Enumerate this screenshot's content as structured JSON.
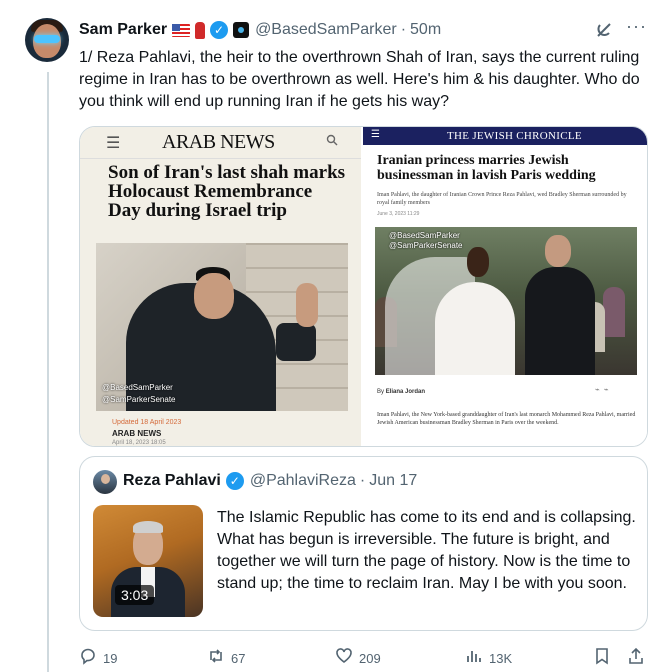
{
  "tweet": {
    "author_name": "Sam Parker",
    "author_handle": "@BasedSamParker",
    "time": "50m",
    "text": "1/ Reza Pahlavi, the heir to the overthrown Shah of Iran, says the current ruling regime in Iran has to be overthrown as well. Here's him & his daughter. Who do you think will end up running Iran if he gets his way?",
    "icons": {
      "grok": "grok-icon",
      "more": "more-icon",
      "verified": "verified-badge-icon",
      "flag": "us-flag-icon",
      "extinguisher": "fire-extinguisher-icon"
    }
  },
  "media": {
    "arab_news": {
      "logo": "ARAB NEWS",
      "headline": "Son of Iran's last shah marks Holocaust Remembrance Day during Israel trip",
      "watermark_1": "@BasedSamParker",
      "watermark_2": "@SamParkerSenate",
      "updated": "Updated 18 April 2023",
      "source": "ARAB NEWS",
      "date": "April 18, 2023 18:05"
    },
    "jewish_chronicle": {
      "logo": "THE JEWISH CHRONICLE",
      "headline": "Iranian princess marries Jewish businessman in lavish Paris wedding",
      "standfirst": "Iman Pahlavi, the daughter of Iranian Crown Prince Reza Pahlavi, wed Bradley Sherman surrounded by royal family members",
      "date": "June 3, 2023 11:29",
      "watermark_1": "@BasedSamParker",
      "watermark_2": "@SamParkerSenate",
      "byline_prefix": "By",
      "byline_author": "Eliana Jordan",
      "caption": "Iman Pahlavi, the New York-based granddaughter of Iran's last monarch Mohammed Reza Pahlavi, married Jewish American businessman Bradley Sherman in Paris over the weekend."
    }
  },
  "quote": {
    "author_name": "Reza Pahlavi",
    "author_handle": "@PahlaviReza",
    "time": "Jun 17",
    "video_duration": "3:03",
    "text": "The Islamic Republic has come to its end and is collapsing. What has begun is irreversible. The future is bright, and together we will turn the page of history. Now is the time to stand up; the time to reclaim Iran. May I be with you soon."
  },
  "actions": {
    "replies": "19",
    "reposts": "67",
    "likes": "209",
    "views": "13K"
  },
  "colors": {
    "accent": "#1d9bf0",
    "secondary_text": "#536471",
    "border": "#cfd9de",
    "jc_navy": "#1b2160"
  }
}
